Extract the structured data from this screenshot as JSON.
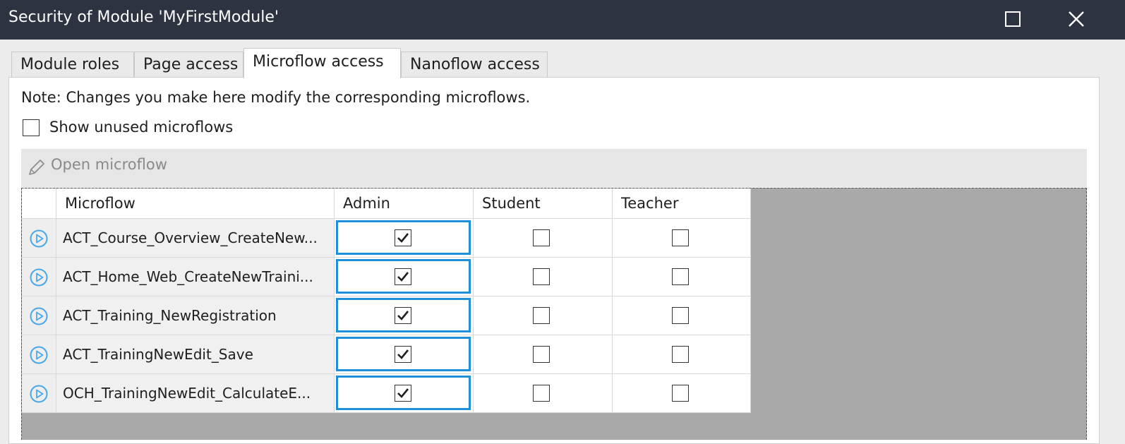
{
  "window": {
    "title": "Security of Module 'MyFirstModule'"
  },
  "tabs": [
    {
      "label": "Module roles",
      "active": false
    },
    {
      "label": "Page access",
      "active": false
    },
    {
      "label": "Microflow access",
      "active": true
    },
    {
      "label": "Nanoflow access",
      "active": false
    }
  ],
  "note": "Note: Changes you make here modify the corresponding microflows.",
  "show_unused": {
    "label": "Show unused microflows",
    "checked": false
  },
  "toolbar": {
    "open_label": "Open microflow",
    "open_enabled": false
  },
  "table": {
    "columns": [
      "Microflow",
      "Admin",
      "Student",
      "Teacher"
    ],
    "rows": [
      {
        "name": "ACT_Course_Overview_CreateNew...",
        "admin": true,
        "student": false,
        "teacher": false
      },
      {
        "name": "ACT_Home_Web_CreateNewTraini...",
        "admin": true,
        "student": false,
        "teacher": false
      },
      {
        "name": "ACT_Training_NewRegistration",
        "admin": true,
        "student": false,
        "teacher": false
      },
      {
        "name": "ACT_TrainingNewEdit_Save",
        "admin": true,
        "student": false,
        "teacher": false
      },
      {
        "name": "OCH_TrainingNewEdit_CalculateE...",
        "admin": true,
        "student": false,
        "teacher": false
      }
    ]
  },
  "icons": {
    "maximize": "maximize-icon",
    "close": "close-icon",
    "pencil": "pencil-icon",
    "microflow": "microflow-play-icon",
    "check": "checkmark-icon"
  },
  "colors": {
    "titlebar": "#2e3342",
    "selection": "#1e8fd8",
    "microflow_icon": "#4aa8e8",
    "empty_area": "#a9a9a9"
  }
}
